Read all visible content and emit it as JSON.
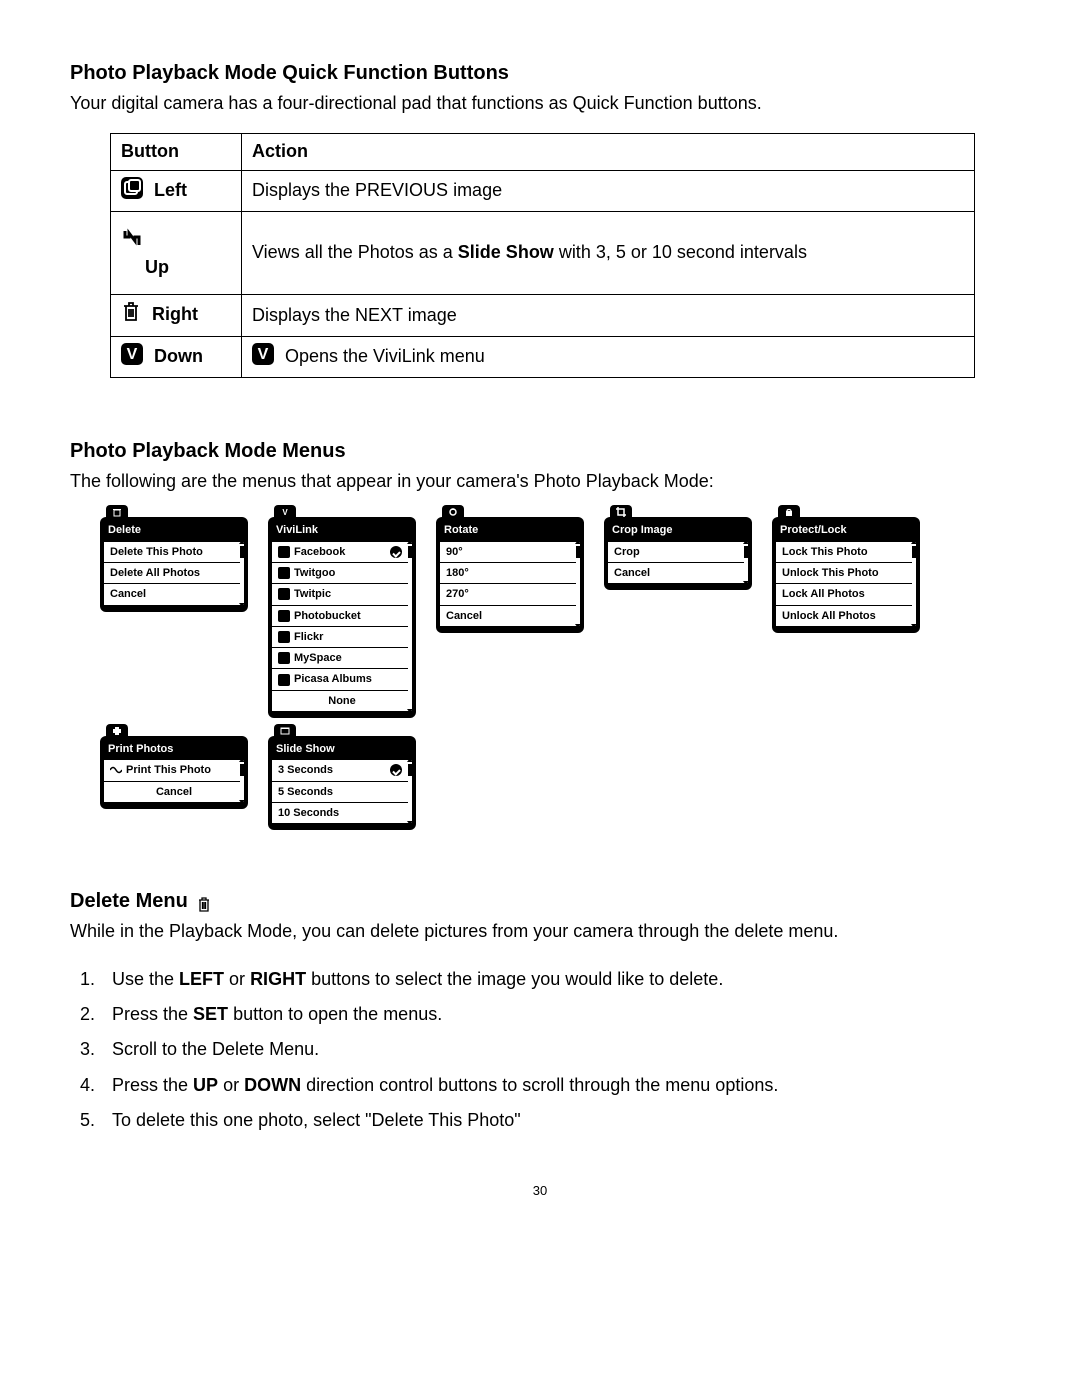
{
  "section1": {
    "heading": "Photo Playback Mode Quick Function Buttons",
    "intro": "Your digital camera has a four-directional pad that functions as Quick Function buttons."
  },
  "table": {
    "header_button": "Button",
    "header_action": "Action",
    "rows": {
      "left": {
        "label": "Left",
        "action": "Displays the PREVIOUS image"
      },
      "up": {
        "label": "Up",
        "action_prefix": "Views all the Photos as a ",
        "action_bold": "Slide Show",
        "action_suffix": " with 3, 5 or 10 second intervals"
      },
      "right": {
        "label": "Right",
        "action": "Displays the NEXT image"
      },
      "down": {
        "label": "Down",
        "action": " Opens the ViviLink menu"
      }
    }
  },
  "section2": {
    "heading": "Photo Playback Mode Menus",
    "intro": "The following are the menus that appear in your camera's Photo Playback Mode:"
  },
  "menus": {
    "delete": {
      "title": "Delete",
      "items": [
        "Delete This Photo",
        "Delete All Photos",
        "Cancel"
      ]
    },
    "vivilink": {
      "title": "ViviLink",
      "items": [
        "Facebook",
        "Twitgoo",
        "Twitpic",
        "Photobucket",
        "Flickr",
        "MySpace",
        "Picasa Albums",
        "None"
      ]
    },
    "rotate": {
      "title": "Rotate",
      "items": [
        "90°",
        "180°",
        "270°",
        "Cancel"
      ]
    },
    "crop": {
      "title": "Crop Image",
      "items": [
        "Crop",
        "Cancel"
      ]
    },
    "protect": {
      "title": "Protect/Lock",
      "items": [
        "Lock This Photo",
        "Unlock This Photo",
        "Lock All Photos",
        "Unlock All Photos"
      ]
    },
    "print": {
      "title": "Print Photos",
      "items": [
        "Print This Photo",
        "Cancel"
      ]
    },
    "slideshow": {
      "title": "Slide Show",
      "items": [
        "3 Seconds",
        "5 Seconds",
        "10 Seconds"
      ]
    }
  },
  "section3": {
    "heading": "Delete Menu",
    "intro": "While in the Playback Mode, you can delete pictures from your camera through the delete menu."
  },
  "steps": {
    "s1a": "Use the ",
    "s1b": "LEFT",
    "s1c": " or ",
    "s1d": "RIGHT",
    "s1e": " buttons to select the image you would like to delete.",
    "s2a": "Press the ",
    "s2b": "SET",
    "s2c": " button to open the menus.",
    "s3": "Scroll to the Delete Menu.",
    "s4a": "Press the ",
    "s4b": "UP",
    "s4c": " or ",
    "s4d": "DOWN",
    "s4e": " direction control buttons to scroll through the menu options.",
    "s5": "To delete this one photo, select \"Delete This Photo\""
  },
  "page_number": "30"
}
